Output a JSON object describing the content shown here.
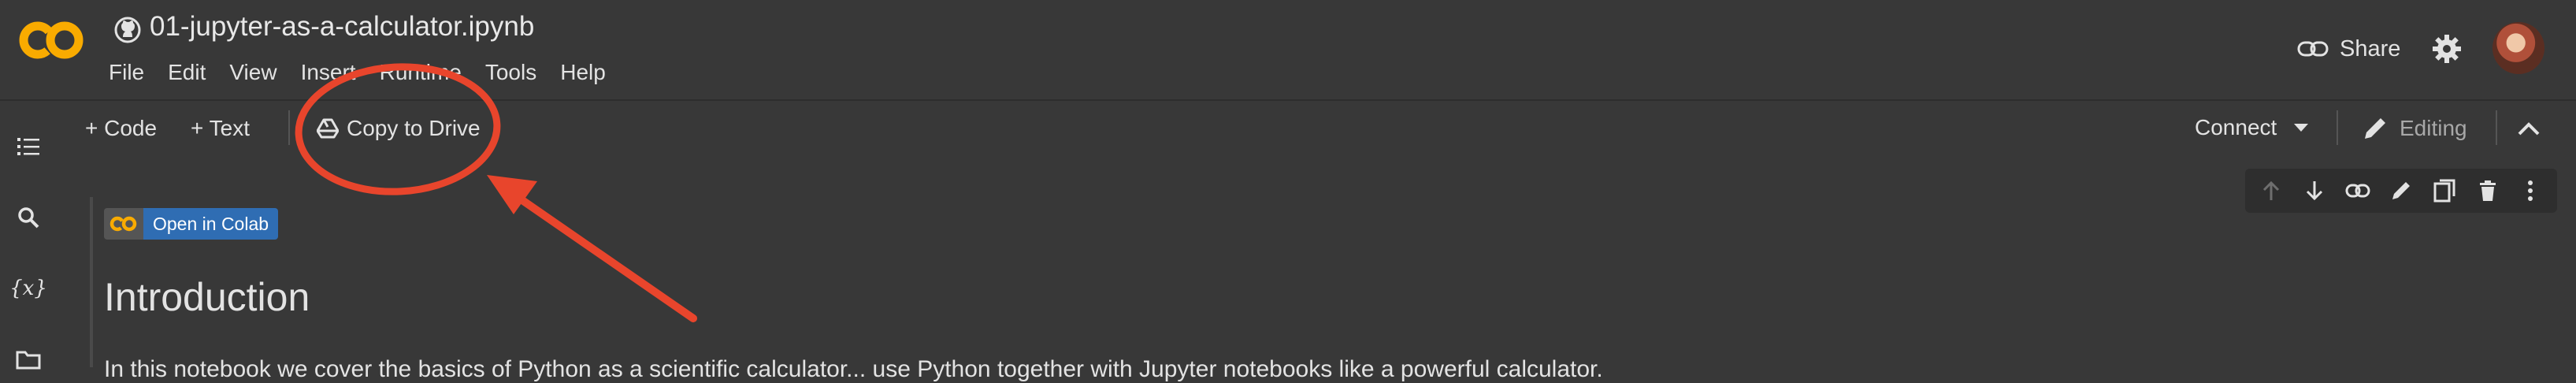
{
  "header": {
    "notebook_title": "01-jupyter-as-a-calculator.ipynb",
    "logo_text": "CO",
    "menu": [
      "File",
      "Edit",
      "View",
      "Insert",
      "Runtime",
      "Tools",
      "Help"
    ],
    "share_label": "Share"
  },
  "toolbar": {
    "code_label": "+ Code",
    "text_label": "+ Text",
    "copy_to_drive_label": "Copy to Drive",
    "connect_label": "Connect",
    "editing_label": "Editing"
  },
  "sidebar": {
    "icons": [
      "table-of-contents-icon",
      "search-icon",
      "variables-icon",
      "files-icon"
    ],
    "variables_glyph": "{x}"
  },
  "cell": {
    "badge_label": "Open in Colab",
    "heading": "Introduction",
    "body_partial": "In this notebook we cover the basics of Python as a scientific calculator... use Python together with Jupyter notebooks like a powerful calculator."
  },
  "colors": {
    "background": "#383838",
    "accent_orange": "#f9ab00",
    "badge_blue": "#2f6db3",
    "annotation_red": "#e8452c"
  }
}
